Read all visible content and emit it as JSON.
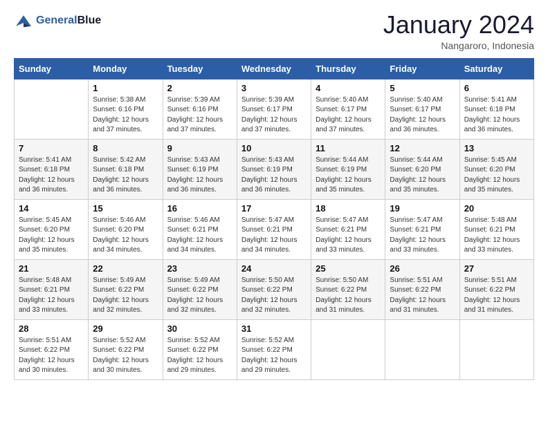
{
  "header": {
    "logo_line1": "General",
    "logo_line2": "Blue",
    "month_title": "January 2024",
    "location": "Nangaroro, Indonesia"
  },
  "days_of_week": [
    "Sunday",
    "Monday",
    "Tuesday",
    "Wednesday",
    "Thursday",
    "Friday",
    "Saturday"
  ],
  "weeks": [
    [
      {
        "day": "",
        "info": ""
      },
      {
        "day": "1",
        "info": "Sunrise: 5:38 AM\nSunset: 6:16 PM\nDaylight: 12 hours and 37 minutes."
      },
      {
        "day": "2",
        "info": "Sunrise: 5:39 AM\nSunset: 6:16 PM\nDaylight: 12 hours and 37 minutes."
      },
      {
        "day": "3",
        "info": "Sunrise: 5:39 AM\nSunset: 6:17 PM\nDaylight: 12 hours and 37 minutes."
      },
      {
        "day": "4",
        "info": "Sunrise: 5:40 AM\nSunset: 6:17 PM\nDaylight: 12 hours and 37 minutes."
      },
      {
        "day": "5",
        "info": "Sunrise: 5:40 AM\nSunset: 6:17 PM\nDaylight: 12 hours and 36 minutes."
      },
      {
        "day": "6",
        "info": "Sunrise: 5:41 AM\nSunset: 6:18 PM\nDaylight: 12 hours and 36 minutes."
      }
    ],
    [
      {
        "day": "7",
        "info": "Sunrise: 5:41 AM\nSunset: 6:18 PM\nDaylight: 12 hours and 36 minutes."
      },
      {
        "day": "8",
        "info": "Sunrise: 5:42 AM\nSunset: 6:18 PM\nDaylight: 12 hours and 36 minutes."
      },
      {
        "day": "9",
        "info": "Sunrise: 5:43 AM\nSunset: 6:19 PM\nDaylight: 12 hours and 36 minutes."
      },
      {
        "day": "10",
        "info": "Sunrise: 5:43 AM\nSunset: 6:19 PM\nDaylight: 12 hours and 36 minutes."
      },
      {
        "day": "11",
        "info": "Sunrise: 5:44 AM\nSunset: 6:19 PM\nDaylight: 12 hours and 35 minutes."
      },
      {
        "day": "12",
        "info": "Sunrise: 5:44 AM\nSunset: 6:20 PM\nDaylight: 12 hours and 35 minutes."
      },
      {
        "day": "13",
        "info": "Sunrise: 5:45 AM\nSunset: 6:20 PM\nDaylight: 12 hours and 35 minutes."
      }
    ],
    [
      {
        "day": "14",
        "info": "Sunrise: 5:45 AM\nSunset: 6:20 PM\nDaylight: 12 hours and 35 minutes."
      },
      {
        "day": "15",
        "info": "Sunrise: 5:46 AM\nSunset: 6:20 PM\nDaylight: 12 hours and 34 minutes."
      },
      {
        "day": "16",
        "info": "Sunrise: 5:46 AM\nSunset: 6:21 PM\nDaylight: 12 hours and 34 minutes."
      },
      {
        "day": "17",
        "info": "Sunrise: 5:47 AM\nSunset: 6:21 PM\nDaylight: 12 hours and 34 minutes."
      },
      {
        "day": "18",
        "info": "Sunrise: 5:47 AM\nSunset: 6:21 PM\nDaylight: 12 hours and 33 minutes."
      },
      {
        "day": "19",
        "info": "Sunrise: 5:47 AM\nSunset: 6:21 PM\nDaylight: 12 hours and 33 minutes."
      },
      {
        "day": "20",
        "info": "Sunrise: 5:48 AM\nSunset: 6:21 PM\nDaylight: 12 hours and 33 minutes."
      }
    ],
    [
      {
        "day": "21",
        "info": "Sunrise: 5:48 AM\nSunset: 6:21 PM\nDaylight: 12 hours and 33 minutes."
      },
      {
        "day": "22",
        "info": "Sunrise: 5:49 AM\nSunset: 6:22 PM\nDaylight: 12 hours and 32 minutes."
      },
      {
        "day": "23",
        "info": "Sunrise: 5:49 AM\nSunset: 6:22 PM\nDaylight: 12 hours and 32 minutes."
      },
      {
        "day": "24",
        "info": "Sunrise: 5:50 AM\nSunset: 6:22 PM\nDaylight: 12 hours and 32 minutes."
      },
      {
        "day": "25",
        "info": "Sunrise: 5:50 AM\nSunset: 6:22 PM\nDaylight: 12 hours and 31 minutes."
      },
      {
        "day": "26",
        "info": "Sunrise: 5:51 AM\nSunset: 6:22 PM\nDaylight: 12 hours and 31 minutes."
      },
      {
        "day": "27",
        "info": "Sunrise: 5:51 AM\nSunset: 6:22 PM\nDaylight: 12 hours and 31 minutes."
      }
    ],
    [
      {
        "day": "28",
        "info": "Sunrise: 5:51 AM\nSunset: 6:22 PM\nDaylight: 12 hours and 30 minutes."
      },
      {
        "day": "29",
        "info": "Sunrise: 5:52 AM\nSunset: 6:22 PM\nDaylight: 12 hours and 30 minutes."
      },
      {
        "day": "30",
        "info": "Sunrise: 5:52 AM\nSunset: 6:22 PM\nDaylight: 12 hours and 29 minutes."
      },
      {
        "day": "31",
        "info": "Sunrise: 5:52 AM\nSunset: 6:22 PM\nDaylight: 12 hours and 29 minutes."
      },
      {
        "day": "",
        "info": ""
      },
      {
        "day": "",
        "info": ""
      },
      {
        "day": "",
        "info": ""
      }
    ]
  ]
}
